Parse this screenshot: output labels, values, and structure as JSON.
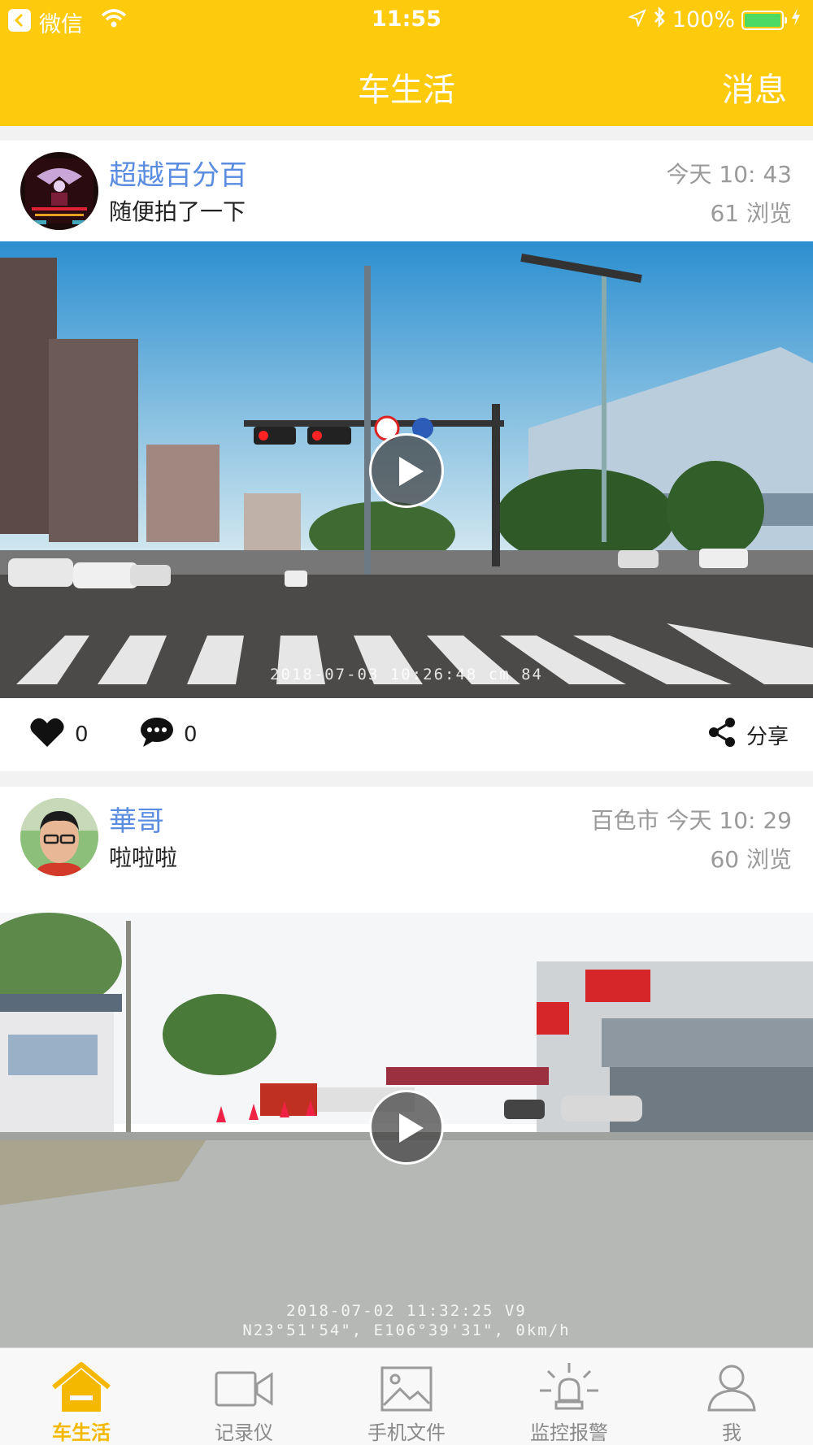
{
  "status_bar": {
    "carrier": "微信",
    "time": "11:55",
    "battery": "100%",
    "icons": [
      "back-icon",
      "wifi-icon",
      "location-icon",
      "bluetooth-icon",
      "battery-icon",
      "charging-icon"
    ]
  },
  "nav": {
    "title": "车生活",
    "messages_label": "消息"
  },
  "posts": [
    {
      "username": "超越百分百",
      "caption": "随便拍了一下",
      "time": "今天 10: 43",
      "views": "61 浏览",
      "video_stamp": "2018-07-03  10:26:48  cm 84",
      "likes": "0",
      "comments": "0",
      "share_label": "分享"
    },
    {
      "username": "華哥",
      "caption": "啦啦啦",
      "time": "百色市 今天 10: 29",
      "views": "60 浏览",
      "video_stamp_line1": "2018-07-02  11:32:25  V9",
      "video_stamp_line2": "N23°51'54\", E106°39'31\", 0km/h"
    }
  ],
  "tabbar": {
    "tabs": [
      {
        "label": "车生活",
        "icon": "home-icon",
        "active": true
      },
      {
        "label": "记录仪",
        "icon": "video-camera-icon",
        "active": false
      },
      {
        "label": "手机文件",
        "icon": "image-icon",
        "active": false
      },
      {
        "label": "监控报警",
        "icon": "alarm-light-icon",
        "active": false
      },
      {
        "label": "我",
        "icon": "profile-icon",
        "active": false
      }
    ]
  },
  "colors": {
    "brand_yellow": "#fdca0c",
    "username_blue": "#5a8de0",
    "active_tab": "#f5b800"
  }
}
